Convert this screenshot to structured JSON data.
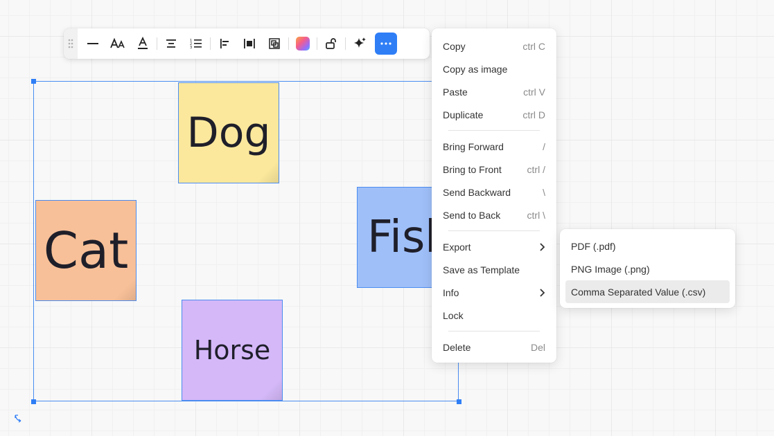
{
  "canvas": {
    "notes": {
      "dog": "Dog",
      "cat": "Cat",
      "fish": "Fish",
      "horse": "Horse"
    },
    "note_colors": {
      "dog": "#fbe89c",
      "cat": "#f8c098",
      "fish": "#9fbff9",
      "horse": "#d4b8f8"
    },
    "selection_color": "#2f7ef6"
  },
  "toolbar": {
    "buttons": [
      "drag-handle-icon",
      "line-style-icon",
      "font-size-icon",
      "text-color-icon",
      "text-align-center-icon",
      "numbered-list-icon",
      "align-left-icon",
      "distribute-horizontal-icon",
      "group-icon",
      "color-fill-icon",
      "unlock-icon",
      "ai-sparkle-icon",
      "more-options-icon"
    ],
    "more_button_color": "#2f7ef6"
  },
  "context_menu": {
    "copy": {
      "label": "Copy",
      "shortcut": "ctrl C"
    },
    "copy_image": {
      "label": "Copy as image"
    },
    "paste": {
      "label": "Paste",
      "shortcut": "ctrl V"
    },
    "duplicate": {
      "label": "Duplicate",
      "shortcut": "ctrl D"
    },
    "bring_forward": {
      "label": "Bring Forward",
      "shortcut": "/"
    },
    "bring_front": {
      "label": "Bring to Front",
      "shortcut": "ctrl /"
    },
    "send_backward": {
      "label": "Send Backward",
      "shortcut": "\\"
    },
    "send_back": {
      "label": "Send to Back",
      "shortcut": "ctrl \\"
    },
    "export": {
      "label": "Export"
    },
    "save_template": {
      "label": "Save as Template"
    },
    "info": {
      "label": "Info"
    },
    "lock": {
      "label": "Lock"
    },
    "delete": {
      "label": "Delete",
      "shortcut": "Del"
    }
  },
  "export_submenu": {
    "pdf": "PDF (.pdf)",
    "png": "PNG Image (.png)",
    "csv": "Comma Separated Value (.csv)",
    "highlighted": "csv"
  }
}
